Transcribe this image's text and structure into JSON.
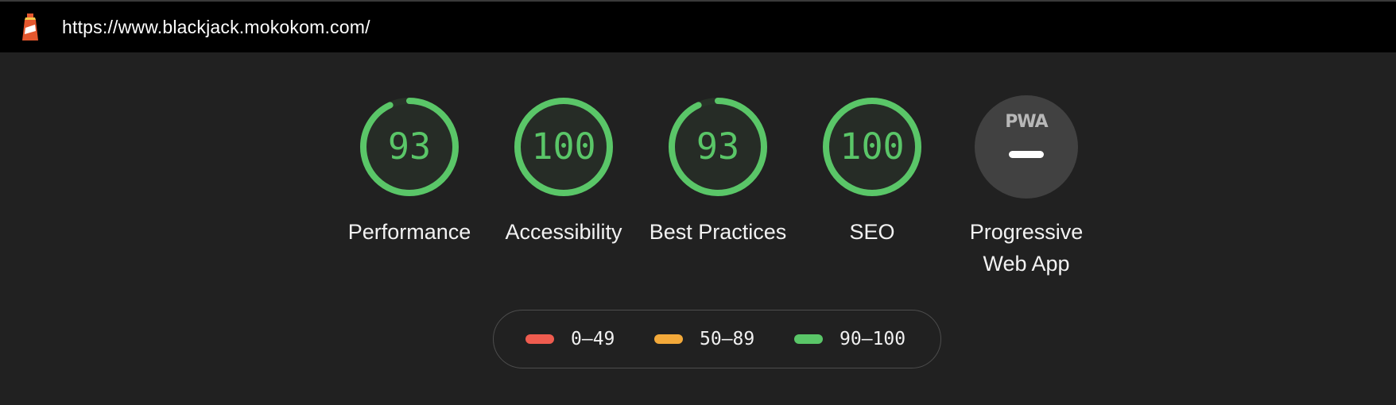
{
  "topbar": {
    "url": "https://www.blackjack.mokokom.com/",
    "logo_icon": "lighthouse-icon"
  },
  "gauges": [
    {
      "id": "performance",
      "score": "93",
      "label": "Performance",
      "fraction": 0.93,
      "color": "#5ac668"
    },
    {
      "id": "accessibility",
      "score": "100",
      "label": "Accessibility",
      "fraction": 1.0,
      "color": "#5ac668"
    },
    {
      "id": "best-practices",
      "score": "93",
      "label": "Best Practices",
      "fraction": 0.93,
      "color": "#5ac668"
    },
    {
      "id": "seo",
      "score": "100",
      "label": "SEO",
      "fraction": 1.0,
      "color": "#5ac668"
    }
  ],
  "pwa": {
    "badge_text": "PWA",
    "label": "Progressive Web App"
  },
  "legend": [
    {
      "range": "0–49",
      "color": "#ef5c4f"
    },
    {
      "range": "50–89",
      "color": "#f3a93a"
    },
    {
      "range": "90–100",
      "color": "#5ac668"
    }
  ],
  "colors": {
    "background": "#212121",
    "topbar": "#000000",
    "pass": "#5ac668",
    "gauge_fill": "#242b25"
  }
}
